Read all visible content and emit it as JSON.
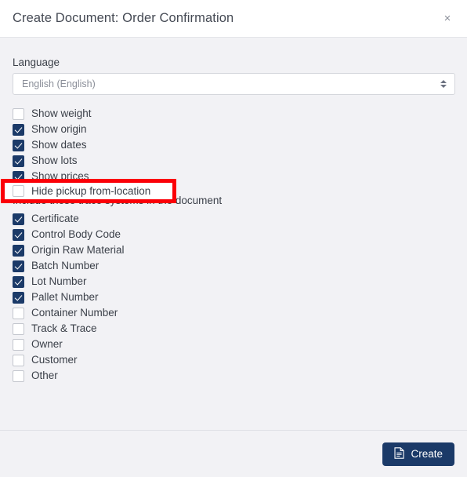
{
  "dialog": {
    "title": "Create Document: Order Confirmation",
    "close_label": "×",
    "close_icon": "close-icon"
  },
  "form": {
    "language_label": "Language",
    "language_value": "English (English)",
    "select_icon": "chevron-updown-icon"
  },
  "display_options": [
    {
      "label": "Show weight",
      "checked": false
    },
    {
      "label": "Show origin",
      "checked": true
    },
    {
      "label": "Show dates",
      "checked": true
    },
    {
      "label": "Show lots",
      "checked": true
    },
    {
      "label": "Show prices",
      "checked": true
    }
  ],
  "highlighted_option": {
    "label": "Hide pickup from-location",
    "checked": false,
    "outline_color": "#fb0007"
  },
  "trace": {
    "section_title": "Include these trace systems in the document",
    "options": [
      {
        "label": "Certificate",
        "checked": true
      },
      {
        "label": "Control Body Code",
        "checked": true
      },
      {
        "label": "Origin Raw Material",
        "checked": true
      },
      {
        "label": "Batch Number",
        "checked": true
      },
      {
        "label": "Lot Number",
        "checked": true
      },
      {
        "label": "Pallet Number",
        "checked": true
      },
      {
        "label": "Container Number",
        "checked": false
      },
      {
        "label": "Track & Trace",
        "checked": false
      },
      {
        "label": "Owner",
        "checked": false
      },
      {
        "label": "Customer",
        "checked": false
      },
      {
        "label": "Other",
        "checked": false
      }
    ]
  },
  "footer": {
    "create_label": "Create",
    "create_icon": "document-icon",
    "accent_color": "#1b3a68"
  }
}
